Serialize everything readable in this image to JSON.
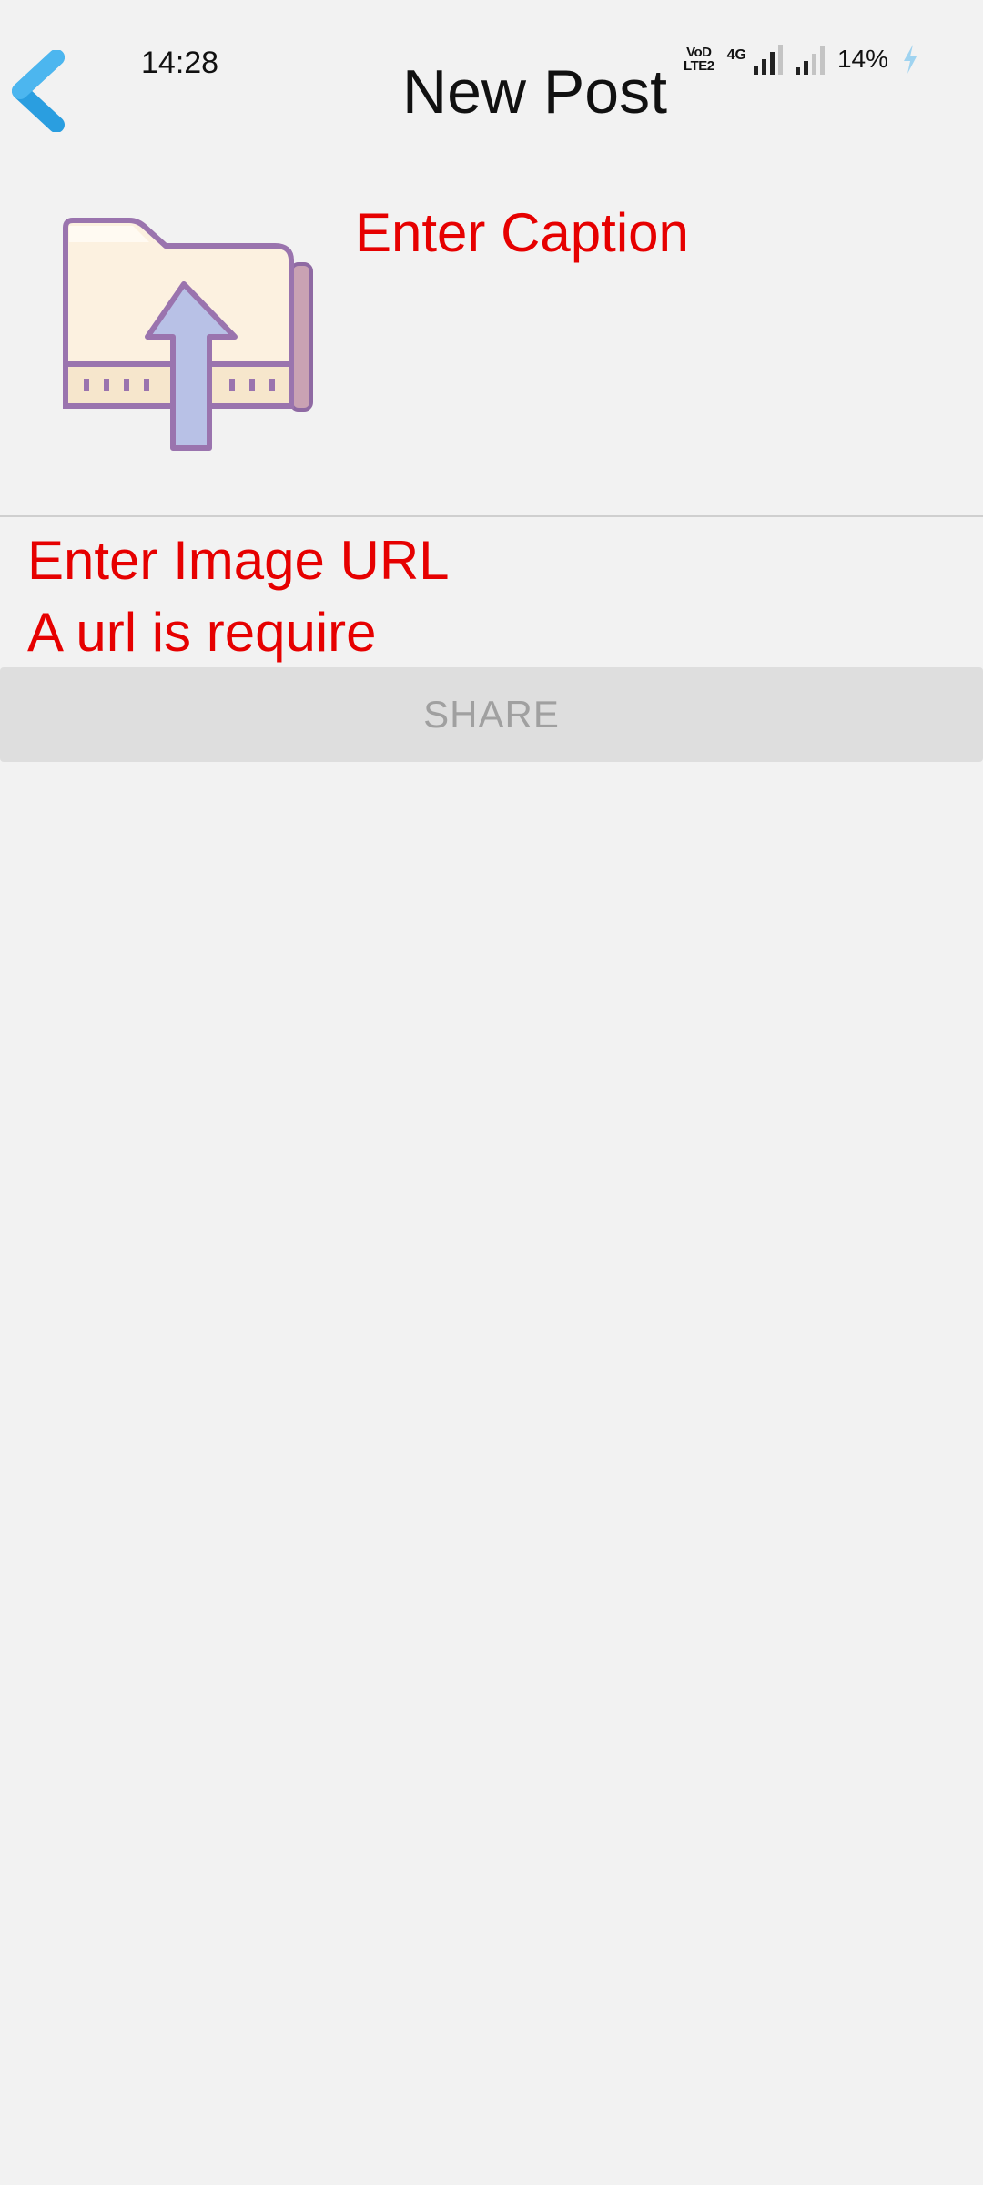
{
  "status_bar": {
    "time": "14:28",
    "volte_top": "VoD",
    "volte_bottom": "LTE2",
    "network": "4G",
    "battery": "14%"
  },
  "header": {
    "title": "New Post"
  },
  "form": {
    "caption_placeholder": "Enter Caption",
    "url_placeholder": "Enter Image URL",
    "url_error": "A url is require",
    "share_label": "SHARE"
  },
  "colors": {
    "accent_blue": "#2a9ee0",
    "error_red": "#e60000",
    "button_bg": "#dedede"
  }
}
